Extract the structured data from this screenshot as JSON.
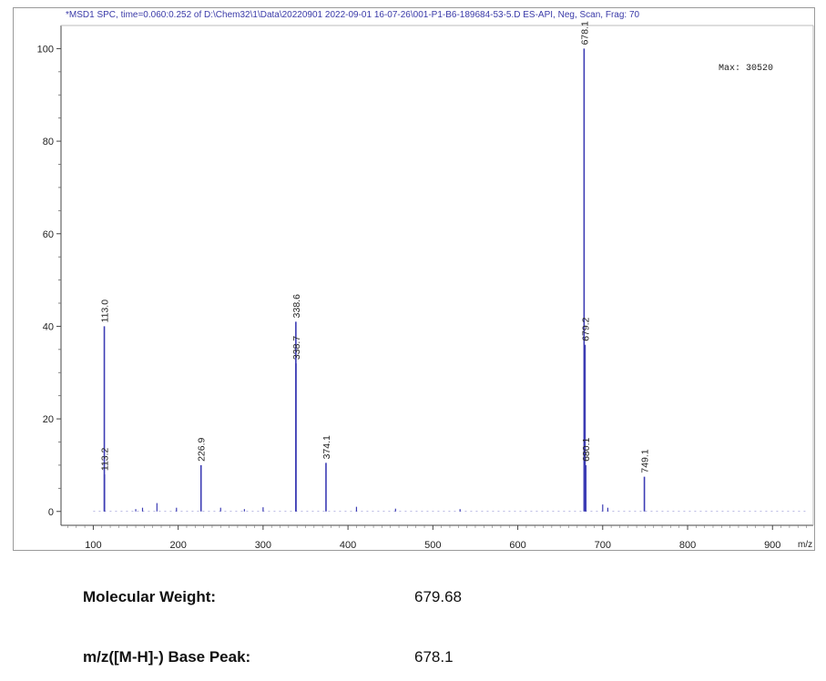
{
  "header": "*MSD1 SPC, time=0.060:0.252 of D:\\Chem32\\1\\Data\\20220901 2022-09-01 16-07-26\\001-P1-B6-189684-53-5.D   ES-API, Neg, Scan, Frag: 70",
  "info": {
    "mw_label": "Molecular Weight:",
    "mw_value": "679.68",
    "bp_label": "m/z([M-H]-) Base Peak:",
    "bp_value": "678.1"
  },
  "chart_data": {
    "type": "bar",
    "title": "",
    "xlabel": "m/z",
    "ylabel": "",
    "xlim": [
      62,
      948
    ],
    "ylim": [
      -3,
      105
    ],
    "xticks": [
      100,
      200,
      300,
      400,
      500,
      600,
      700,
      800,
      900
    ],
    "yticks": [
      0,
      20,
      40,
      60,
      80,
      100
    ],
    "max_label": "Max: 30520",
    "color": "#3c3cb4",
    "peaks": [
      {
        "mz": 113.0,
        "intensity": 40,
        "label": "113.0"
      },
      {
        "mz": 113.2,
        "intensity": 8,
        "label": "113.2"
      },
      {
        "mz": 226.9,
        "intensity": 10,
        "label": "226.9"
      },
      {
        "mz": 338.6,
        "intensity": 41,
        "label": "338.6"
      },
      {
        "mz": 338.7,
        "intensity": 32,
        "label": "338.7"
      },
      {
        "mz": 374.1,
        "intensity": 10.5,
        "label": "374.1"
      },
      {
        "mz": 678.1,
        "intensity": 100,
        "label": "678.1"
      },
      {
        "mz": 679.2,
        "intensity": 36,
        "label": "679.2"
      },
      {
        "mz": 680.1,
        "intensity": 10,
        "label": "680.1"
      },
      {
        "mz": 749.1,
        "intensity": 7.5,
        "label": "749.1"
      }
    ],
    "minor_peaks": [
      {
        "mz": 150,
        "intensity": 0.5
      },
      {
        "mz": 158,
        "intensity": 0.8
      },
      {
        "mz": 175,
        "intensity": 1.8
      },
      {
        "mz": 198,
        "intensity": 0.8
      },
      {
        "mz": 250,
        "intensity": 0.8
      },
      {
        "mz": 278,
        "intensity": 0.5
      },
      {
        "mz": 300,
        "intensity": 0.9
      },
      {
        "mz": 410,
        "intensity": 1
      },
      {
        "mz": 456,
        "intensity": 0.6
      },
      {
        "mz": 532,
        "intensity": 0.5
      },
      {
        "mz": 700,
        "intensity": 1.5
      },
      {
        "mz": 706,
        "intensity": 0.8
      }
    ]
  }
}
